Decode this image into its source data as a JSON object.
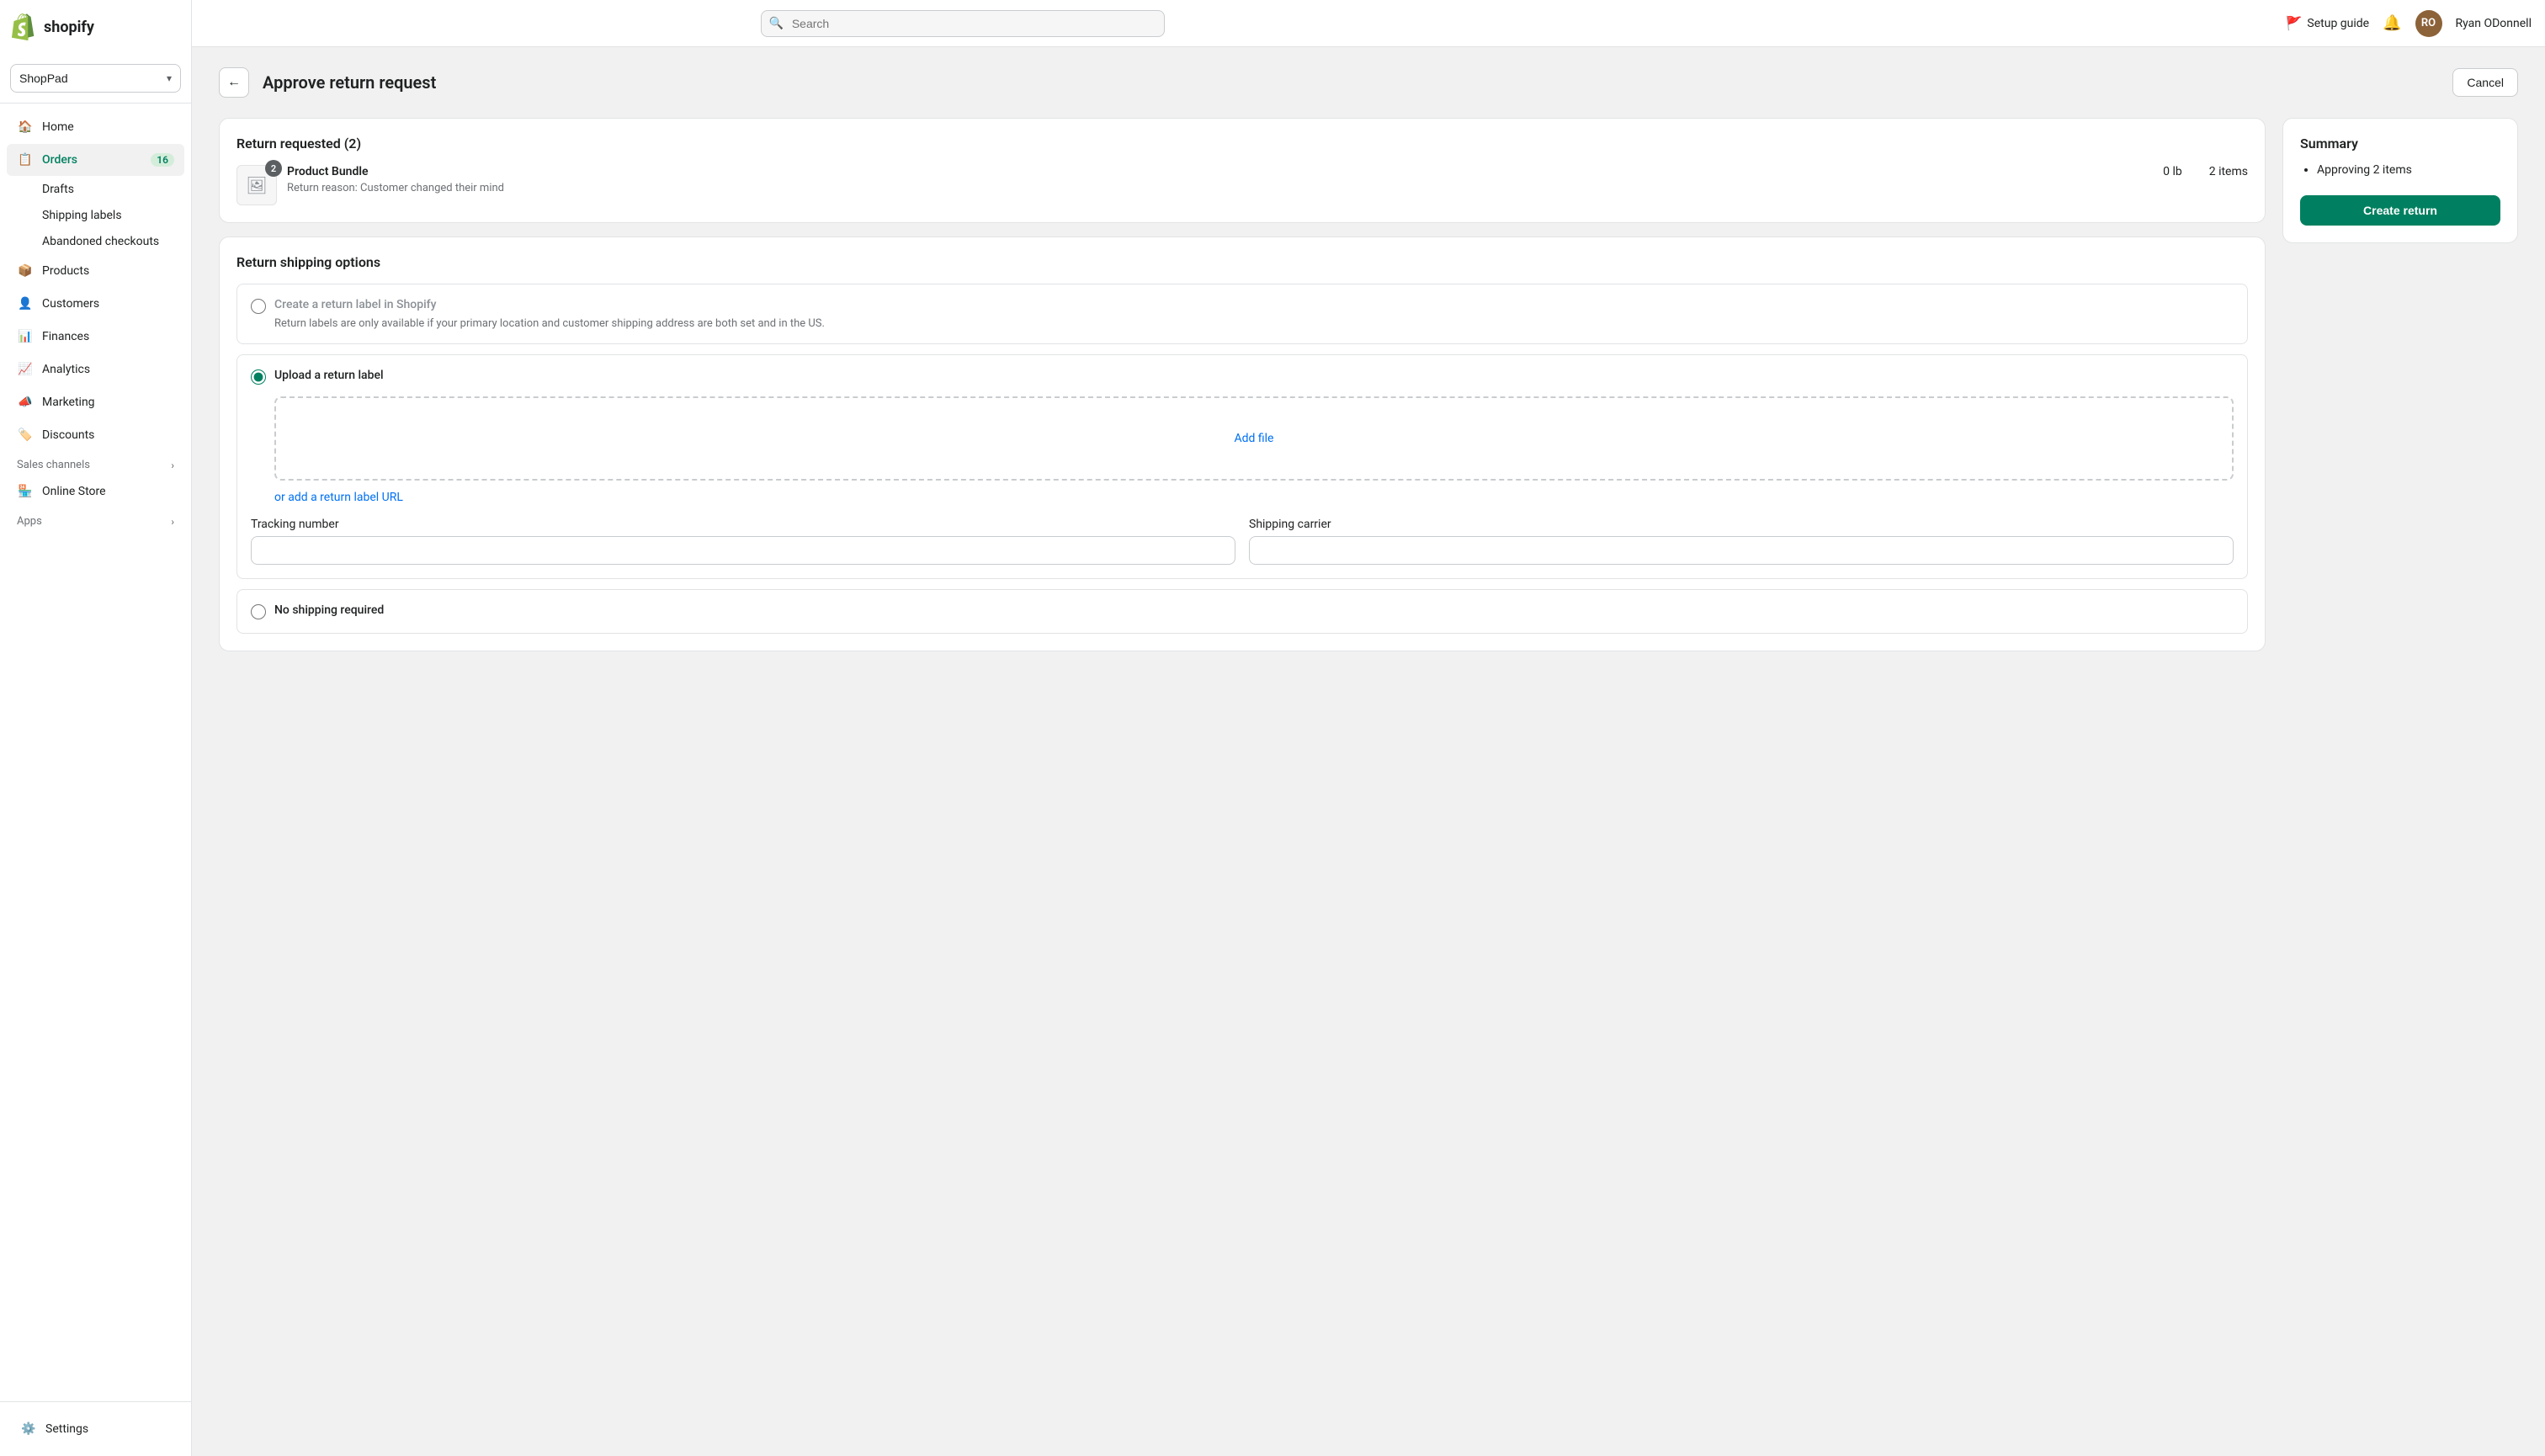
{
  "topbar": {
    "search_placeholder": "Search",
    "setup_guide_label": "Setup guide",
    "user_name": "Ryan ODonnell",
    "user_initials": "RO"
  },
  "sidebar": {
    "store_name": "ShopPad",
    "nav_items": [
      {
        "id": "home",
        "label": "Home",
        "icon": "🏠",
        "badge": null,
        "active": false
      },
      {
        "id": "orders",
        "label": "Orders",
        "icon": "📋",
        "badge": "16",
        "active": true
      },
      {
        "id": "products",
        "label": "Products",
        "icon": "📦",
        "badge": null,
        "active": false
      },
      {
        "id": "customers",
        "label": "Customers",
        "icon": "👤",
        "badge": null,
        "active": false
      },
      {
        "id": "finances",
        "label": "Finances",
        "icon": "📊",
        "badge": null,
        "active": false
      },
      {
        "id": "analytics",
        "label": "Analytics",
        "icon": "📈",
        "badge": null,
        "active": false
      },
      {
        "id": "marketing",
        "label": "Marketing",
        "icon": "📣",
        "badge": null,
        "active": false
      },
      {
        "id": "discounts",
        "label": "Discounts",
        "icon": "🏷️",
        "badge": null,
        "active": false
      }
    ],
    "orders_sub_items": [
      {
        "id": "drafts",
        "label": "Drafts"
      },
      {
        "id": "shipping-labels",
        "label": "Shipping labels"
      },
      {
        "id": "abandoned-checkouts",
        "label": "Abandoned checkouts"
      }
    ],
    "sales_channels_label": "Sales channels",
    "online_store_label": "Online Store",
    "apps_label": "Apps",
    "settings_label": "Settings"
  },
  "page": {
    "title": "Approve return request",
    "cancel_label": "Cancel",
    "back_icon": "←"
  },
  "return_requested": {
    "section_title": "Return requested (2)",
    "product_name": "Product Bundle",
    "product_badge": "2",
    "weight": "0 lb",
    "qty": "2 items",
    "return_reason_label": "Return reason: Customer changed their mind"
  },
  "shipping_options": {
    "section_title": "Return shipping options",
    "option1": {
      "label": "Create a return label in Shopify",
      "description": "Return labels are only available if your primary location and customer shipping address are both set and in the US.",
      "selected": false
    },
    "option2": {
      "label": "Upload a return label",
      "selected": true,
      "upload_cta": "Add file",
      "url_link": "or add a return label URL",
      "tracking_number_label": "Tracking number",
      "tracking_number_placeholder": "",
      "shipping_carrier_label": "Shipping carrier",
      "shipping_carrier_placeholder": ""
    },
    "option3": {
      "label": "No shipping required",
      "selected": false
    }
  },
  "summary": {
    "title": "Summary",
    "approving_text": "Approving 2 items",
    "create_return_label": "Create return"
  }
}
